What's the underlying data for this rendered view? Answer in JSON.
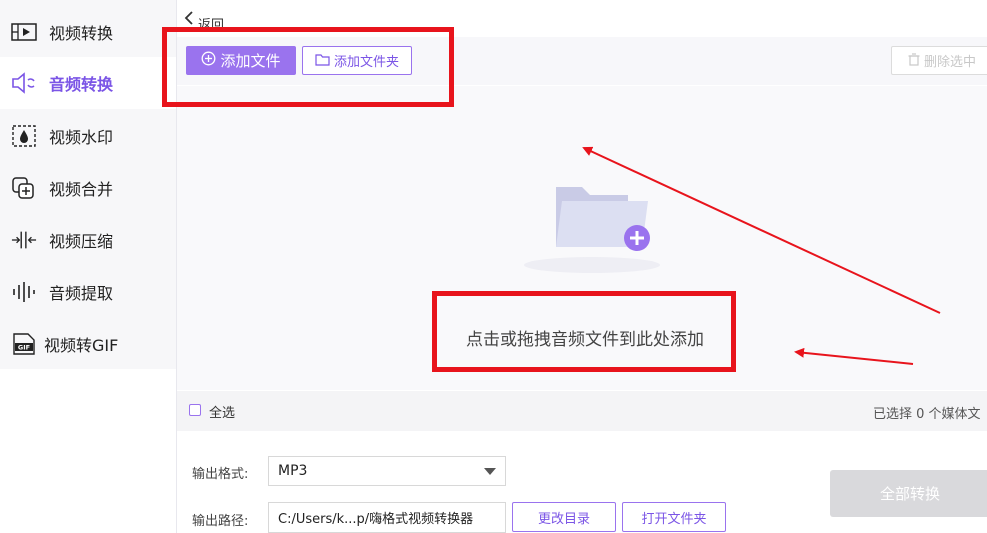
{
  "sidebar": {
    "items": [
      {
        "label": "视频转换",
        "icon": "film-convert-icon"
      },
      {
        "label": "音频转换",
        "icon": "speaker-convert-icon",
        "active": true
      },
      {
        "label": "视频水印",
        "icon": "watermark-drop-icon"
      },
      {
        "label": "视频合并",
        "icon": "merge-plus-icon"
      },
      {
        "label": "视频压缩",
        "icon": "compress-arrows-icon"
      },
      {
        "label": "音频提取",
        "icon": "audio-wave-icon"
      },
      {
        "label": "视频转GIF",
        "icon": "gif-icon"
      }
    ]
  },
  "header": {
    "back_label": "返回"
  },
  "toolbar": {
    "add_file_label": "添加文件",
    "add_folder_label": "添加文件夹",
    "delete_selected_label": "删除选中"
  },
  "dropzone": {
    "hint": "点击或拖拽音频文件到此处添加"
  },
  "selection": {
    "select_all_label": "全选",
    "count_text": "已选择 0 个媒体文"
  },
  "output": {
    "format_label": "输出格式:",
    "format_value": "MP3",
    "path_label": "输出路径:",
    "path_value": "C:/Users/k...p/嗨格式视频转换器",
    "change_dir_label": "更改目录",
    "open_folder_label": "打开文件夹"
  },
  "convert_all_label": "全部转换",
  "colors": {
    "accent": "#9a73ee",
    "accent_text": "#7b55e6",
    "annotation": "#e8141c"
  }
}
